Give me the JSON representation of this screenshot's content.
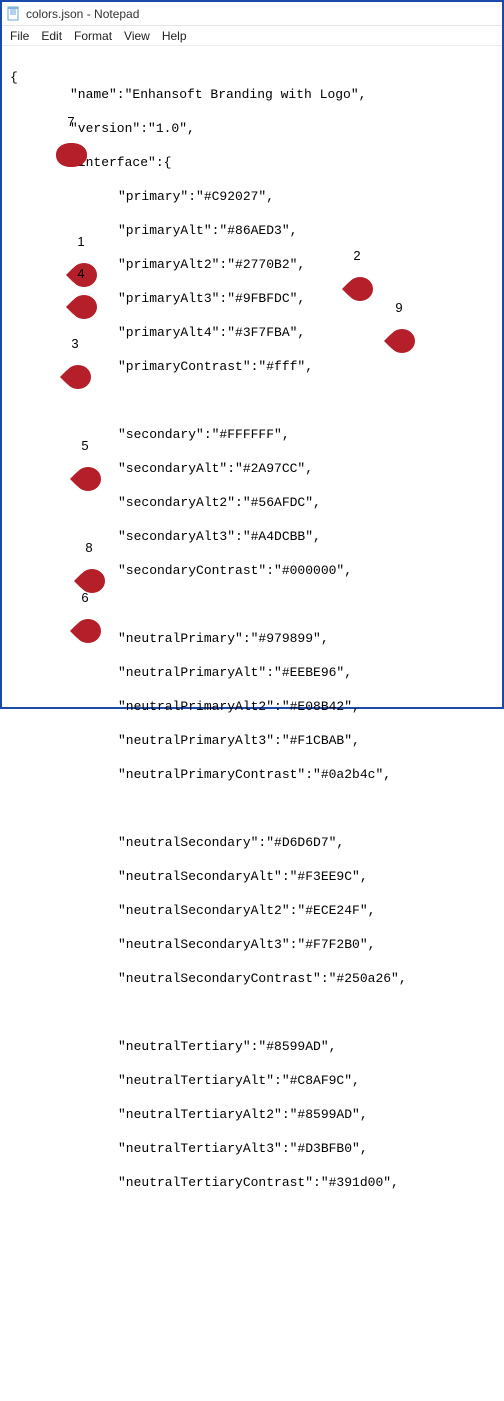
{
  "window": {
    "title": "colors.json - Notepad"
  },
  "menu": {
    "file": "File",
    "edit": "Edit",
    "format": "Format",
    "view": "View",
    "help": "Help"
  },
  "content": {
    "brace_open": "{",
    "name_line": "\"name\":\"Enhansoft Branding with Logo\",",
    "version_line": "\"version\":\"1.0\",",
    "interface_line": "\"interface\":{",
    "primary": "\"primary\":\"#C92027\",",
    "primaryAlt": "\"primaryAlt\":\"#86AED3\",",
    "primaryAlt2": "\"primaryAlt2\":\"#2770B2\",",
    "primaryAlt3": "\"primaryAlt3\":\"#9FBFDC\",",
    "primaryAlt4": "\"primaryAlt4\":\"#3F7FBA\",",
    "primaryContrast": "\"primaryContrast\":\"#fff\",",
    "secondary": "\"secondary\":\"#FFFFFF\",",
    "secondaryAlt": "\"secondaryAlt\":\"#2A97CC\",",
    "secondaryAlt2": "\"secondaryAlt2\":\"#56AFDC\",",
    "secondaryAlt3": "\"secondaryAlt3\":\"#A4DCBB\",",
    "secondaryContrast": "\"secondaryContrast\":\"#000000\",",
    "neutralPrimary": "\"neutralPrimary\":\"#979899\",",
    "neutralPrimaryAlt": "\"neutralPrimaryAlt\":\"#EEBE96\",",
    "neutralPrimaryAlt2": "\"neutralPrimaryAlt2\":\"#E08B42\",",
    "neutralPrimaryAlt3": "\"neutralPrimaryAlt3\":\"#F1CBAB\",",
    "neutralPrimaryContrast": "\"neutralPrimaryContrast\":\"#0a2b4c\",",
    "neutralSecondary": "\"neutralSecondary\":\"#D6D6D7\",",
    "neutralSecondaryAlt": "\"neutralSecondaryAlt\":\"#F3EE9C\",",
    "neutralSecondaryAlt2": "\"neutralSecondaryAlt2\":\"#ECE24F\",",
    "neutralSecondaryAlt3": "\"neutralSecondaryAlt3\":\"#F7F2B0\",",
    "neutralSecondaryContrast": "\"neutralSecondaryContrast\":\"#250a26\",",
    "neutralTertiary": "\"neutralTertiary\":\"#8599AD\",",
    "neutralTertiaryAlt": "\"neutralTertiaryAlt\":\"#C8AF9C\",",
    "neutralTertiaryAlt2": "\"neutralTertiaryAlt2\":\"#8599AD\",",
    "neutralTertiaryAlt3": "\"neutralTertiaryAlt3\":\"#D3BFB0\",",
    "neutralTertiaryContrast": "\"neutralTertiaryContrast\":\"#391d00\","
  },
  "markers": {
    "m1": "1",
    "m2": "2",
    "m3": "3",
    "m4": "4",
    "m5": "5",
    "m6": "6",
    "m7": "7",
    "m8": "8",
    "m9": "9"
  }
}
